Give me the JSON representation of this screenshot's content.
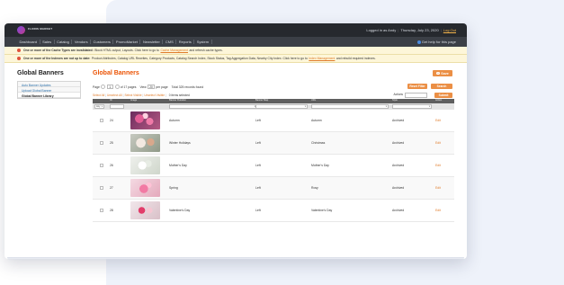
{
  "header": {
    "logo_text": "FLORIS MARKET",
    "logged_in": "Logged in as Andy",
    "date": "Thursday, July 23, 2020",
    "logout": "Log Out"
  },
  "nav": {
    "items": [
      "Dashboard",
      "Sales",
      "Catalog",
      "Vendors",
      "Customers",
      "PromoMarket",
      "Newsletter",
      "CMS",
      "Reports",
      "System"
    ],
    "help": "Get help for this page"
  },
  "messages": [
    {
      "bold": "One or more of the Cache Types are invalidated:",
      "text": "Block HTML output, Layouts. Click here to go to",
      "link": "Cache Management",
      "after": "and refresh cache types."
    },
    {
      "bold": "One or more of the Indexes are not up to date:",
      "text": "Product Attributes, Catalog URL Rewrites, Category Products, Catalog Search Index, Stock Status, Tag Aggregation Data, Nearby City Index. Click here to go to",
      "link": "Index Management",
      "after": "and rebuild required indexes."
    }
  ],
  "sidebar": {
    "title": "Global Banners",
    "items": [
      "Auto Banner Updates",
      "Upload Global Banner",
      "Global Banner Library"
    ]
  },
  "main": {
    "title": "Global Banners",
    "add_button": "Save",
    "pager": {
      "page_label": "Page",
      "page_value": "1",
      "of_pages": "of 17 pages",
      "view_label": "View",
      "view_value": "20",
      "per_page": "per page",
      "total": "Total 325 records found"
    },
    "reset_filter": "Reset Filter",
    "search": "Search",
    "mass": {
      "select_all": "Select All",
      "unselect_all": "Unselect All",
      "select_visible": "Select Visible",
      "unselect_visible": "Unselect Visible",
      "selected": "0 items selected",
      "actions_label": "Actions",
      "submit": "Submit"
    }
  },
  "grid": {
    "headers": [
      "",
      "ID",
      "Image",
      "Banner Duration",
      "Banner Map",
      "URL",
      "Style",
      "Action"
    ],
    "filter_any": "Any",
    "rows": [
      {
        "id": "24",
        "name": "Autumn",
        "position": "Left",
        "style": "Autumn",
        "status": "Archived",
        "action": "Edit",
        "thumb": "autumn"
      },
      {
        "id": "25",
        "name": "Winter Holidays",
        "position": "Left",
        "style": "Christmas",
        "status": "Archived",
        "action": "Edit",
        "thumb": "winter"
      },
      {
        "id": "26",
        "name": "Mother's Day",
        "position": "Left",
        "style": "Mother's Day",
        "status": "Archived",
        "action": "Edit",
        "thumb": "mother"
      },
      {
        "id": "27",
        "name": "Spring",
        "position": "Left",
        "style": "Rosy",
        "status": "Archived",
        "action": "Edit",
        "thumb": "spring"
      },
      {
        "id": "28",
        "name": "Valentine's Day",
        "position": "Left",
        "style": "Valentine's Day",
        "status": "Archived",
        "action": "Edit",
        "thumb": "val"
      }
    ]
  }
}
